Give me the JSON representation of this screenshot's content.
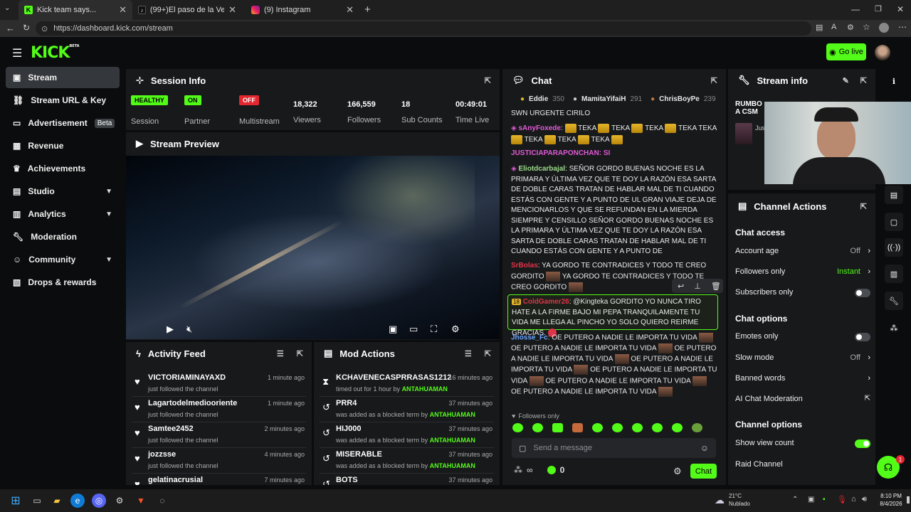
{
  "browser": {
    "tabs": [
      {
        "title": "Kick team says...",
        "icon": "kick-favicon"
      },
      {
        "title": "(99+)El paso de la Vergüenza #sh",
        "icon": "tiktok-favicon"
      },
      {
        "title": "(9) Instagram",
        "icon": "instagram-favicon"
      }
    ],
    "url": "https://dashboard.kick.com/stream"
  },
  "header": {
    "logo": "KICK",
    "logo_badge": "BETA",
    "go_live": "Go live"
  },
  "sidebar": {
    "items": [
      {
        "label": "Stream",
        "icon": "stream-icon"
      },
      {
        "label": "Stream URL & Key",
        "icon": "link-icon"
      },
      {
        "label": "Advertisement",
        "badge": "Beta",
        "icon": "ad-icon"
      },
      {
        "label": "Revenue",
        "icon": "revenue-icon"
      },
      {
        "label": "Achievements",
        "icon": "trophy-icon"
      },
      {
        "label": "Studio",
        "icon": "studio-icon"
      },
      {
        "label": "Analytics",
        "icon": "analytics-icon"
      },
      {
        "label": "Moderation",
        "icon": "wrench-icon"
      },
      {
        "label": "Community",
        "icon": "community-icon"
      },
      {
        "label": "Drops & rewards",
        "icon": "gift-icon"
      }
    ]
  },
  "session": {
    "title": "Session Info",
    "health": "HEALTHY",
    "health_label": "Session",
    "partner": "ON",
    "partner_label": "Partner",
    "multistream": "OFF",
    "multistream_label": "Multistream",
    "viewers": "18,322",
    "viewers_label": "Viewers",
    "followers": "166,559",
    "followers_label": "Followers",
    "subs": "18",
    "subs_label": "Sub Counts",
    "time": "00:49:01",
    "time_label": "Time Live"
  },
  "preview": {
    "title": "Stream Preview"
  },
  "activity": {
    "title": "Activity Feed",
    "rows": [
      {
        "name": "VICTORIAMINAYAXD",
        "sub": "just followed the channel",
        "time": "1 minute ago"
      },
      {
        "name": "Lagartodelmediooriente",
        "sub": "just followed the channel",
        "time": "1 minute ago"
      },
      {
        "name": "Samtee2452",
        "sub": "just followed the channel",
        "time": "2 minutes ago"
      },
      {
        "name": "jozzsse",
        "sub": "just followed the channel",
        "time": "4 minutes ago"
      },
      {
        "name": "gelatinacrusial",
        "sub": "",
        "time": "7 minutes ago"
      }
    ]
  },
  "modactions": {
    "title": "Mod Actions",
    "rows": [
      {
        "name": "KCHAVENECASPRRASAS1212",
        "pre": "timed out for 1 hour by ",
        "by": "ANTAHUAMAN",
        "time": "16 minutes ago"
      },
      {
        "name": "PRR4",
        "pre": "was added as a blocked term by ",
        "by": "ANTAHUAMAN",
        "time": "37 minutes ago"
      },
      {
        "name": "HIJ000",
        "pre": "was added as a blocked term by ",
        "by": "ANTAHUAMAN",
        "time": "37 minutes ago"
      },
      {
        "name": "MISERABLE",
        "pre": "was added as a blocked term by ",
        "by": "ANTAHUAMAN",
        "time": "37 minutes ago"
      },
      {
        "name": "BOTS",
        "pre": "",
        "by": "",
        "time": "37 minutes ago"
      }
    ]
  },
  "chat": {
    "title": "Chat",
    "top_gifters": [
      {
        "name": "Eddie",
        "count": "350"
      },
      {
        "name": "MamitaYifaiH",
        "count": "291"
      },
      {
        "name": "ChrisBoyPe",
        "count": "239"
      }
    ],
    "m0": "SWN URGENTE CIRILO",
    "m1_user": "sAnyFoxede",
    "m1_text": "TEKA",
    "m2": "JUSTICIAPARAPONCHAN: SI",
    "m3_user": "Eliotdcarbajal",
    "m3_text": ": SEÑOR GORDO BUENAS NOCHE ES LA PRIMARA Y ÚLTIMA VEZ QUE TE DOY LA RAZÓN ESA SARTA DE DOBLE CARAS TRATAN DE HABLAR MAL DE TI CUANDO ESTÁS CON GENTE Y A PUNTO DE UL GRAN VIAJE DEJA DE MENCIONARLOS Y QUE SE REFUNDAN EN LA MIERDA SIEMPRE Y CENSILLO SEÑOR GORDO BUENAS NOCHE ES LA PRIMARA Y ÚLTIMA VEZ QUE TE DOY LA RAZÓN ESA SARTA DE DOBLE CARAS TRATAN DE HABLAR MAL DE TI CUANDO ESTÁS CON GENTE Y A PUNTO DE",
    "m4_user": "SrBolas",
    "m4_a": ": YA GORDO TE CONTRADICES Y TODO TE CREO GORDITO",
    "m4_b": "YA GORDO TE CONTRADICES Y TODO TE CREO GORDITO",
    "m5_badge": "18",
    "m5_user": "ColdGamer26",
    "m5_text": ": @Kingteka GORDITO YO NUNCA TIRO HATE A LA FIRME BAJO MI PEPA TRANQUILAMENTE TU VIDA ME LLEGA AL PINCHO YO SOLO QUIERO REIRME GRACIAS.",
    "m6_user": "Jhosse_Fc",
    "m6_text": "OE PUTERO A NADIE LE IMPORTA TU VIDA",
    "followers_only": "Followers only",
    "placeholder": "Send a message",
    "points": "0",
    "send": "Chat"
  },
  "streaminfo": {
    "title": "Stream info",
    "title_text": "RUMBO A CSM",
    "sub": "Jus"
  },
  "actions": {
    "title": "Channel Actions",
    "chat_access": "Chat access",
    "account_age": "Account age",
    "account_age_val": "Off",
    "followers_only": "Followers only",
    "followers_only_val": "Instant",
    "subscribers_only": "Subscribers only",
    "chat_options": "Chat options",
    "emotes_only": "Emotes only",
    "slow_mode": "Slow mode",
    "slow_mode_val": "Off",
    "banned_words": "Banned words",
    "ai_mod": "AI Chat Moderation",
    "channel_options": "Channel options",
    "show_view_count": "Show view count",
    "raid": "Raid Channel"
  },
  "taskbar": {
    "temp": "21°C",
    "weather": "Nublado",
    "time": "8:10 PM",
    "date": "8/4/2026",
    "notif": "1"
  },
  "colors": {
    "accent": "#53fc18",
    "panel": "#18191b",
    "bg": "#0b0c0d",
    "off": "#e3262f"
  }
}
